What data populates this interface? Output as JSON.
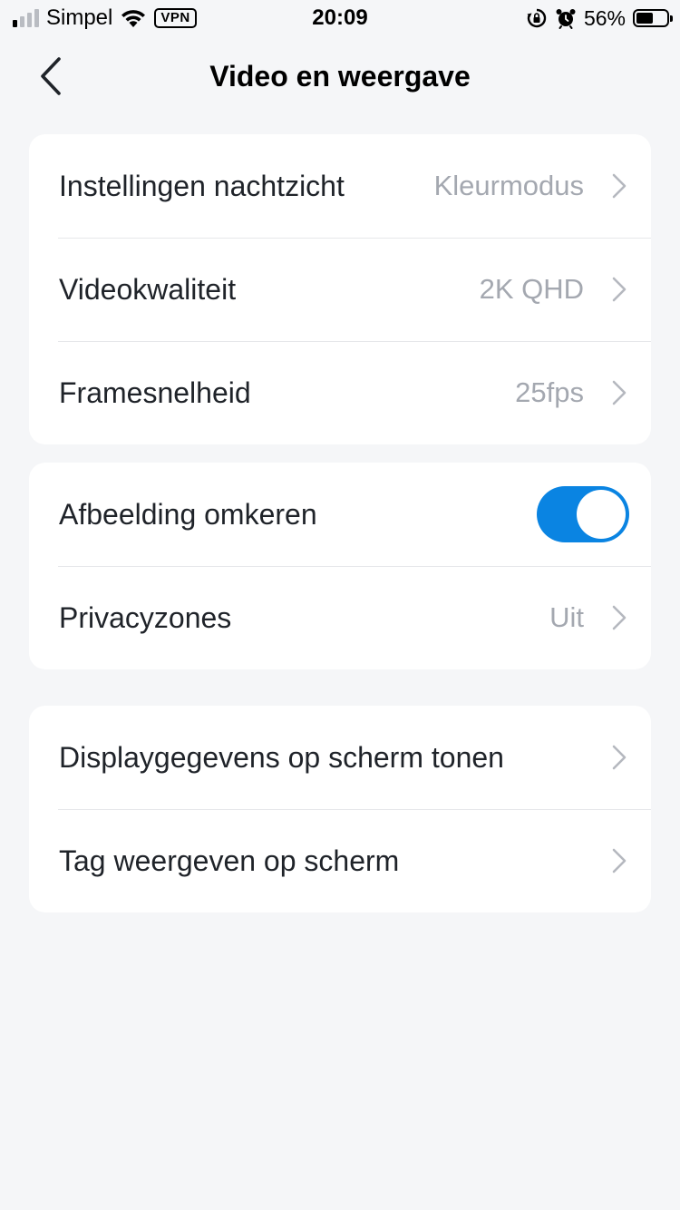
{
  "status_bar": {
    "carrier": "Simpel",
    "vpn": "VPN",
    "time": "20:09",
    "battery_percent": "56%",
    "battery_level": 0.56,
    "signal_bars_active": 1,
    "signal_bars_total": 4
  },
  "nav": {
    "title": "Video en weergave",
    "back_icon": "chevron-left-icon"
  },
  "groups": [
    {
      "rows": [
        {
          "label": "Instellingen nachtzicht",
          "value": "Kleurmodus"
        },
        {
          "label": "Videokwaliteit",
          "value": "2K QHD"
        },
        {
          "label": "Framesnelheid",
          "value": "25fps"
        }
      ]
    },
    {
      "rows": [
        {
          "label": "Afbeelding omkeren",
          "toggle_on": true
        },
        {
          "label": "Privacyzones",
          "value": "Uit"
        }
      ]
    },
    {
      "rows": [
        {
          "label": "Displaygegevens op scherm tonen"
        },
        {
          "label": "Tag weergeven op scherm"
        }
      ]
    }
  ],
  "colors": {
    "accent": "#0a84e2",
    "background": "#f5f6f8",
    "card": "#ffffff",
    "secondary_text": "#a4a8b0",
    "divider": "#e6e7ea"
  }
}
